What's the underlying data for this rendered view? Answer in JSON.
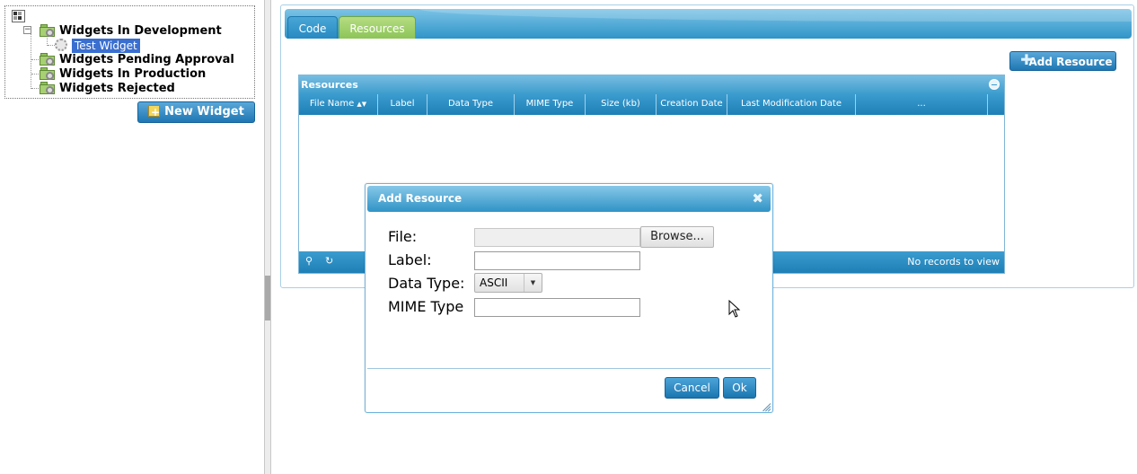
{
  "tree": {
    "root_icon": "tree-root-icon",
    "categories": [
      {
        "label": "Widgets In Development",
        "icon": "folder-gear-icon",
        "expanded": true,
        "children": [
          {
            "label": "Test Widget",
            "icon": "gear-icon",
            "selected": true
          }
        ]
      },
      {
        "label": "Widgets Pending Approval",
        "icon": "folder-gear-icon"
      },
      {
        "label": "Widgets In Production",
        "icon": "folder-gear-icon"
      },
      {
        "label": "Widgets Rejected",
        "icon": "folder-gear-icon"
      }
    ],
    "new_widget_label": "New Widget"
  },
  "tabs": [
    {
      "label": "Code",
      "active": false
    },
    {
      "label": "Resources",
      "active": true
    }
  ],
  "toolbar": {
    "add_resource_label": "Add Resource"
  },
  "grid": {
    "title": "Resources",
    "columns": [
      "File Name",
      "Label",
      "Data Type",
      "MIME Type",
      "Size (kb)",
      "Creation Date",
      "Last Modification Date",
      "..."
    ],
    "sorted_column": "File Name",
    "empty_text": "No records to view"
  },
  "dialog": {
    "title": "Add Resource",
    "close_icon": "close-icon",
    "fields": {
      "file_label": "File:",
      "browse_label": "Browse...",
      "label_label": "Label:",
      "label_value": "",
      "data_type_label": "Data Type:",
      "data_type_value": "ASCII",
      "mime_type_label": "MIME Type",
      "mime_type_value": ""
    },
    "cancel_label": "Cancel",
    "ok_label": "Ok"
  },
  "colors": {
    "accent_blue": "#2f93c6",
    "tab_active_green": "#9ccf6a",
    "selection_blue": "#3a6fd0"
  }
}
